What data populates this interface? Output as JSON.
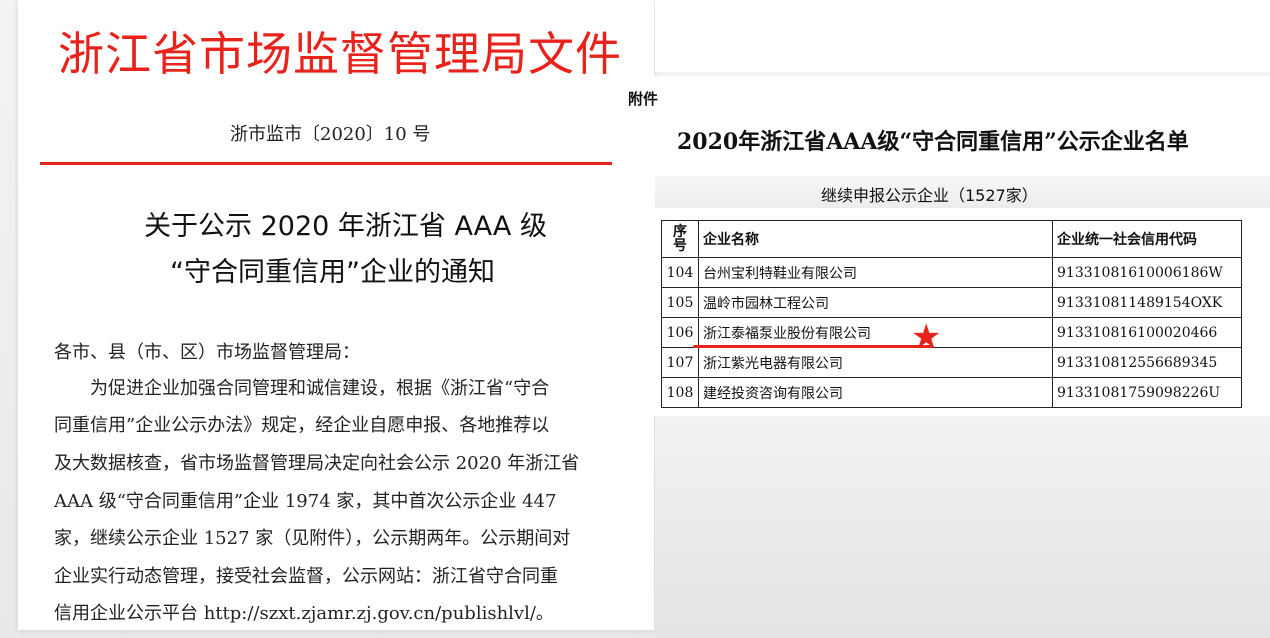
{
  "left_document": {
    "cut_top_text": "",
    "header": "浙江省市场监督管理局文件",
    "doc_number": "浙市监市〔2020〕10 号",
    "title_line_1": "关于公示 2020 年浙江省 AAA 级",
    "title_line_2": "“守合同重信用”企业的通知",
    "greeting": "各市、县（市、区）市场监督管理局：",
    "body_lines": [
      "　　为促进企业加强合同管理和诚信建设，根据《浙江省“守合",
      "同重信用”企业公示办法》规定，经企业自愿申报、各地推荐以",
      "及大数据核查，省市场监督管理局决定向社会公示 2020 年浙江省",
      "AAA 级“守合同重信用”企业 1974 家，其中首次公示企业 447",
      "家，继续公示企业 1527 家（见附件），公示期两年。公示期间对",
      "企业实行动态管理，接受社会监督，公示网站：浙江省守合同重",
      "信用企业公示平台 http://szxt.zjamr.zj.gov.cn/publishlvl/。"
    ]
  },
  "right_document": {
    "top_cut_text": "",
    "attachment_label": "附件",
    "list_title": "2020年浙江省AAA级“守合同重信用”公示企业名单",
    "sub_title": "继续申报公示企业（1527家）",
    "table": {
      "headers": {
        "no": "序号",
        "name": "企业名称",
        "code": "企业统一社会信用代码"
      },
      "rows": [
        {
          "no": "104",
          "name": "台州宝利特鞋业有限公司",
          "code": "91331081610006186W"
        },
        {
          "no": "105",
          "name": "温岭市园林工程公司",
          "code": "913310811489154OXK"
        },
        {
          "no": "106",
          "name": "浙江泰福泵业股份有限公司",
          "code": "913310816100020466"
        },
        {
          "no": "107",
          "name": "浙江紫光电器有限公司",
          "code": "913310812556689345"
        },
        {
          "no": "108",
          "name": "建经投资咨询有限公司",
          "code": "91331081759098226U"
        }
      ]
    },
    "highlight_row": 2,
    "highlight_color": "#e8231c",
    "marker_icon": "star-icon"
  }
}
